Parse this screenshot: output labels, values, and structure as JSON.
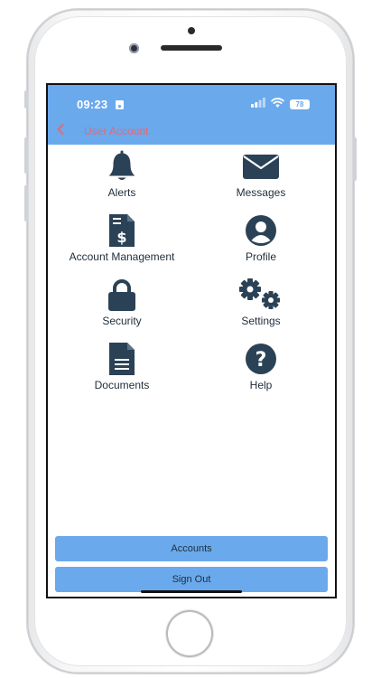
{
  "status_bar": {
    "time": "09:23",
    "battery": "78"
  },
  "nav": {
    "title": "User Account"
  },
  "menu": [
    {
      "label": "Alerts",
      "icon": "bell-icon"
    },
    {
      "label": "Messages",
      "icon": "envelope-icon"
    },
    {
      "label": "Account Management",
      "icon": "invoice-dollar-icon"
    },
    {
      "label": "Profile",
      "icon": "user-circle-icon"
    },
    {
      "label": "Security",
      "icon": "lock-icon"
    },
    {
      "label": "Settings",
      "icon": "gears-icon"
    },
    {
      "label": "Documents",
      "icon": "document-icon"
    },
    {
      "label": "Help",
      "icon": "question-circle-icon"
    }
  ],
  "buttons": {
    "accounts": "Accounts",
    "sign_out": "Sign Out"
  },
  "colors": {
    "header": "#6aa9ec",
    "icon": "#2b4256",
    "title_text": "#e06a7a"
  }
}
